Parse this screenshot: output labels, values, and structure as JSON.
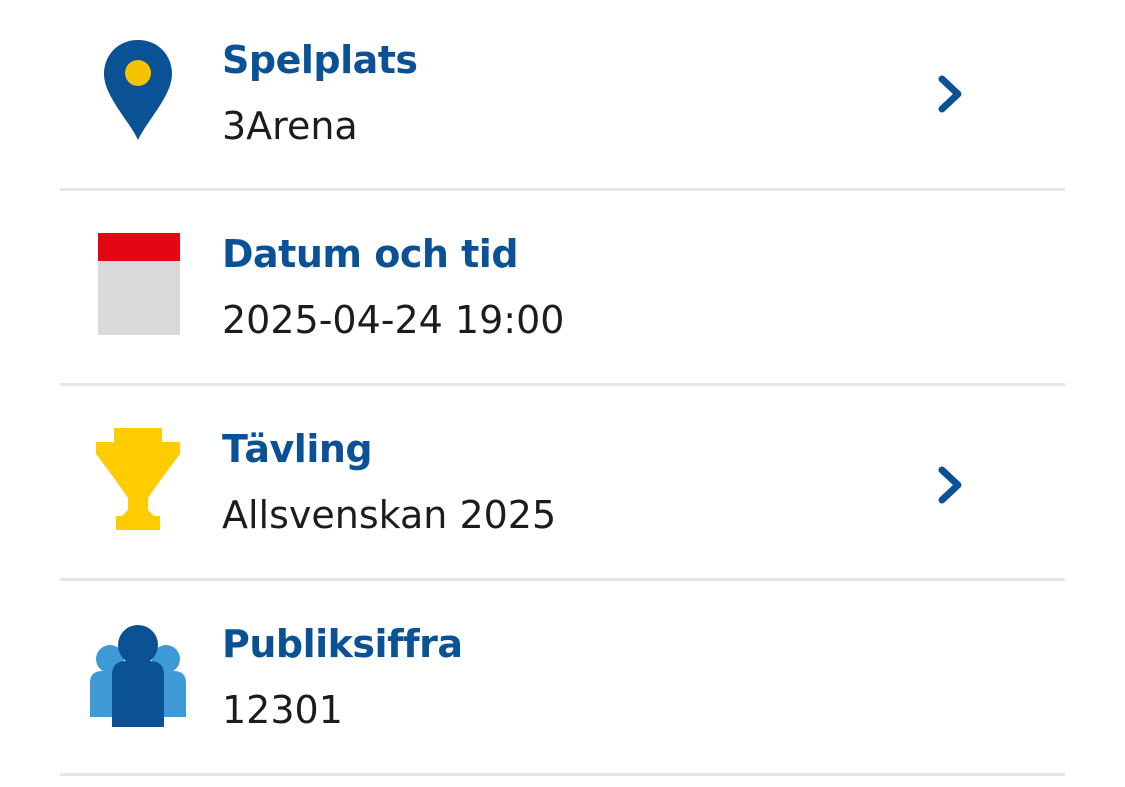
{
  "rows": [
    {
      "title": "Spelplats",
      "value": "3Arena",
      "icon": "location-pin-icon",
      "has_chevron": true
    },
    {
      "title": "Datum och tid",
      "value": "2025-04-24 19:00",
      "icon": "calendar-icon",
      "has_chevron": false
    },
    {
      "title": "Tävling",
      "value": "Allsvenskan 2025",
      "icon": "trophy-icon",
      "has_chevron": true
    },
    {
      "title": "Publiksiffra",
      "value": "12301",
      "icon": "audience-icon",
      "has_chevron": false
    }
  ],
  "colors": {
    "title": "#0a5196",
    "value": "#1c1c1c",
    "divider": "#e6e6e6",
    "pin": "#0a5196",
    "pin_dot": "#f5c400",
    "calendar_top": "#e30613",
    "calendar_body": "#d9d9d9",
    "trophy": "#fecc00",
    "people_front": "#0a5196",
    "people_back": "#3d9ad6"
  }
}
